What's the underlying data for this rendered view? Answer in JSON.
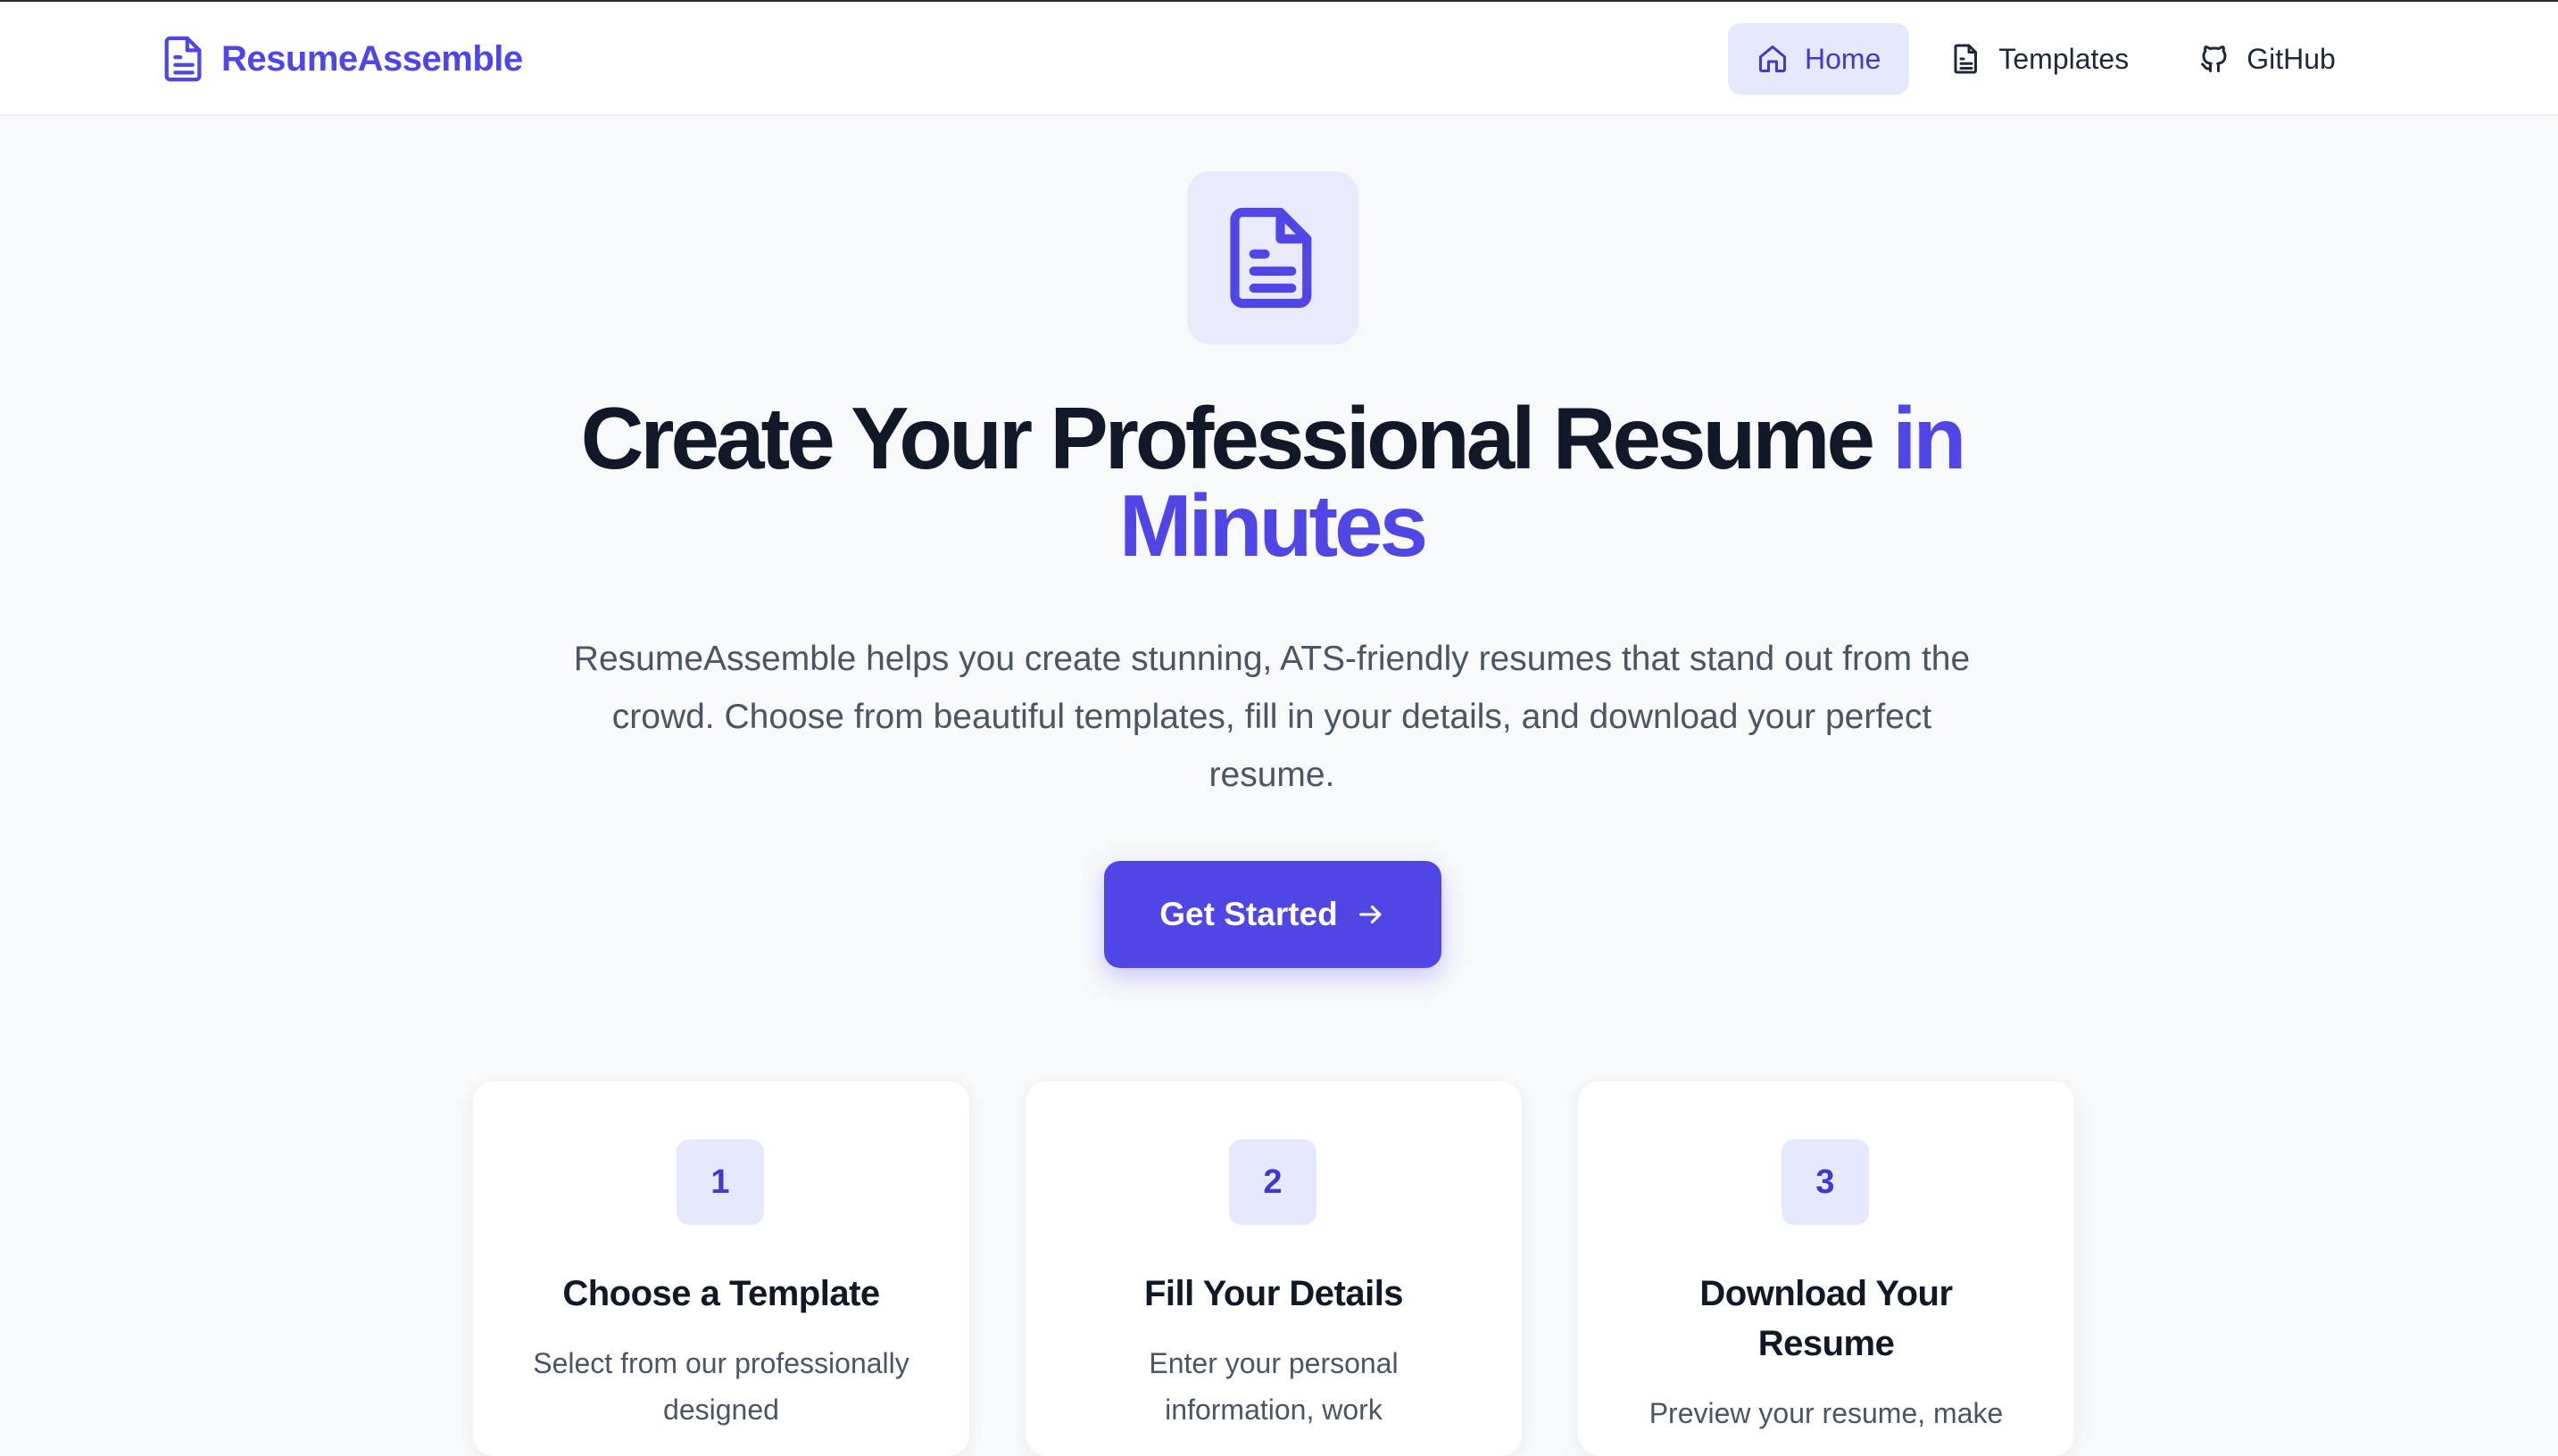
{
  "header": {
    "brand": "ResumeAssemble",
    "nav": [
      {
        "label": "Home",
        "icon": "home-icon",
        "active": true
      },
      {
        "label": "Templates",
        "icon": "document-icon",
        "active": false
      },
      {
        "label": "GitHub",
        "icon": "github-icon",
        "active": false
      }
    ]
  },
  "hero": {
    "icon": "document-icon",
    "title_main": "Create Your Professional Resume ",
    "title_accent": "in Minutes",
    "description": "ResumeAssemble helps you create stunning, ATS-friendly resumes that stand out from the crowd. Choose from beautiful templates, fill in your details, and download your perfect resume.",
    "cta_label": "Get Started"
  },
  "steps": [
    {
      "number": "1",
      "title": "Choose a Template",
      "description": "Select from our professionally designed"
    },
    {
      "number": "2",
      "title": "Fill Your Details",
      "description": "Enter your personal information, work"
    },
    {
      "number": "3",
      "title": "Download Your Resume",
      "description": "Preview your resume, make"
    }
  ],
  "colors": {
    "accent": "#4f46e5",
    "accent_soft": "#e6e9fd",
    "text_dark": "#111827",
    "text_muted": "#4b5563",
    "background": "#f8f9fb"
  }
}
